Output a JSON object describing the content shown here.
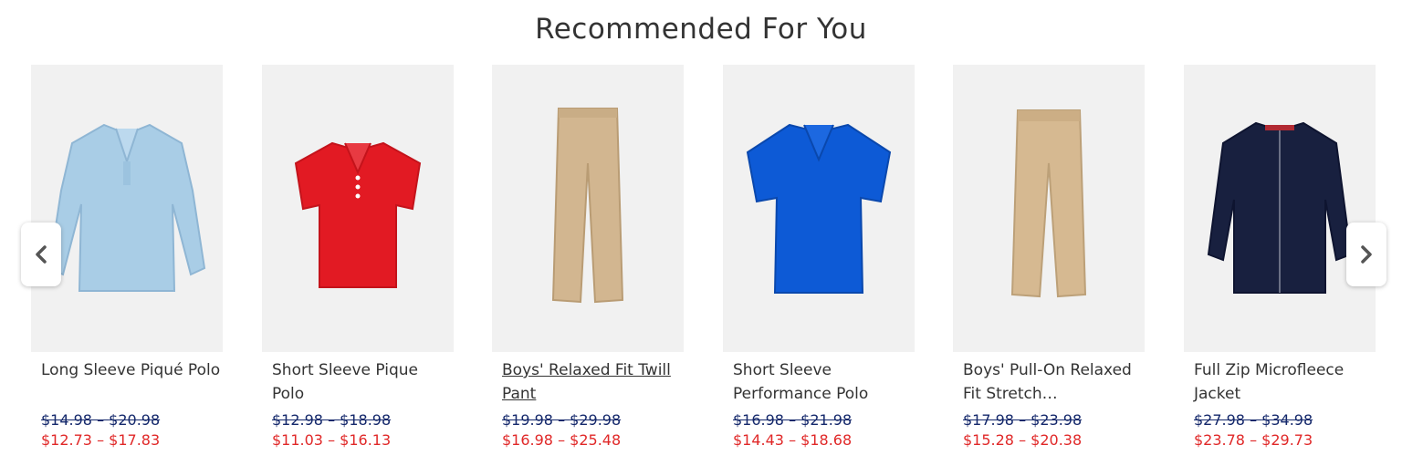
{
  "section": {
    "title": "Recommended For You"
  },
  "nav": {
    "prev_icon": "chevron-left-icon",
    "next_icon": "chevron-right-icon"
  },
  "colors": {
    "original_price": "#14286b",
    "sale_price": "#e02828",
    "image_bg": "#f1f1f1"
  },
  "products": [
    {
      "name": "Long Sleeve Piqué Polo",
      "orig_low": "$14.98",
      "orig_high": "$20.98",
      "sale_low": "$12.73",
      "sale_high": "$17.83",
      "item": "light-blue long sleeve polo",
      "color": "#a9cde6"
    },
    {
      "name": "Short Sleeve Pique Polo",
      "orig_low": "$12.98",
      "orig_high": "$18.98",
      "sale_low": "$11.03",
      "sale_high": "$16.13",
      "item": "red short sleeve polo",
      "color": "#e21a23"
    },
    {
      "name": "Boys' Relaxed Fit Twill Pant",
      "orig_low": "$19.98",
      "orig_high": "$29.98",
      "sale_low": "$16.98",
      "sale_high": "$25.48",
      "item": "khaki pants",
      "color": "#d2b690"
    },
    {
      "name": "Short Sleeve Performance Polo",
      "orig_low": "$16.98",
      "orig_high": "$21.98",
      "sale_low": "$14.43",
      "sale_high": "$18.68",
      "item": "royal blue polo",
      "color": "#0d5ad6"
    },
    {
      "name": "Boys' Pull-On Relaxed Fit Stretch…",
      "orig_low": "$17.98",
      "orig_high": "$23.98",
      "sale_low": "$15.28",
      "sale_high": "$20.38",
      "item": "khaki pull-on pants",
      "color": "#d6b991"
    },
    {
      "name": "Full Zip Microfleece Jacket",
      "orig_low": "$27.98",
      "orig_high": "$34.98",
      "sale_low": "$23.78",
      "sale_high": "$29.73",
      "item": "navy fleece jacket",
      "color": "#18203f"
    }
  ]
}
